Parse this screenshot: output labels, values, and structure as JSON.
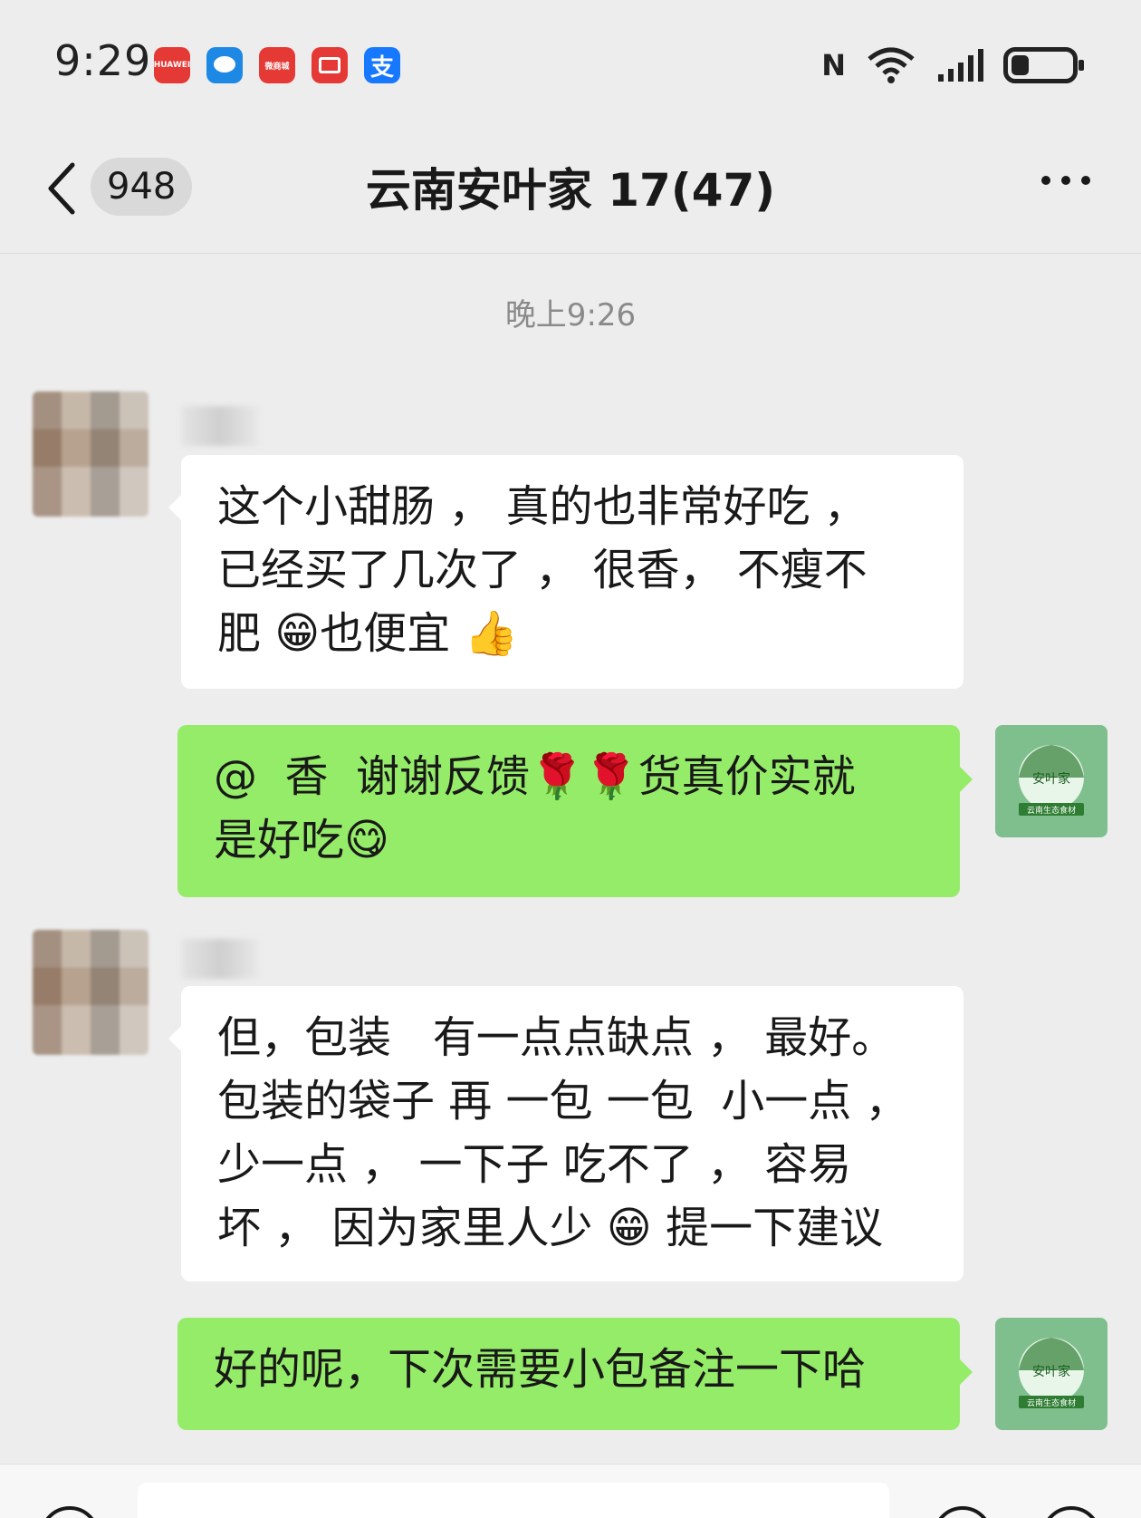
{
  "status_bar": {
    "time": "9:29",
    "apps": [
      {
        "name": "huawei-app-icon",
        "label": "HUAWEI",
        "color": "#e53935"
      },
      {
        "name": "message-app-icon",
        "label": "",
        "color": "#1e88e5"
      },
      {
        "name": "mall-app-icon",
        "label": "微商城",
        "color": "#e53935"
      },
      {
        "name": "red-app-icon",
        "label": "",
        "color": "#e53935"
      },
      {
        "name": "alipay-app-icon",
        "label": "支",
        "color": "#1677ff"
      }
    ],
    "nfc_label": "N",
    "battery_level": 0.3
  },
  "nav": {
    "unread_count": "948",
    "title": "云南安叶家 17(47)"
  },
  "time_divider": "晚上9:26",
  "messages": [
    {
      "direction": "in",
      "text": "这个小甜肠 ， 真的也非常好吃 ，\n已经买了几次了 ， 很香， 不瘦不\n肥 😁也便宜 👍"
    },
    {
      "direction": "out",
      "text": "@  香  谢谢反馈🌹🌹货真价实就\n是好吃😋"
    },
    {
      "direction": "in",
      "text": "但，包装   有一点点缺点 ， 最好。\n包装的袋子 再 一包 一包  小一点 ，\n少一点 ， 一下子 吃不了 ， 容易\n坏 ， 因为家里人少 😁 提一下建议"
    },
    {
      "direction": "out",
      "text": "好的呢，下次需要小包备注一下哈"
    }
  ],
  "shop_avatar": {
    "brand": "安叶家",
    "caption": "云南生态食材",
    "color": "#7fbf8e"
  },
  "colors": {
    "outgoing_bubble": "#95ec69",
    "incoming_bubble": "#ffffff",
    "background": "#ededed"
  }
}
